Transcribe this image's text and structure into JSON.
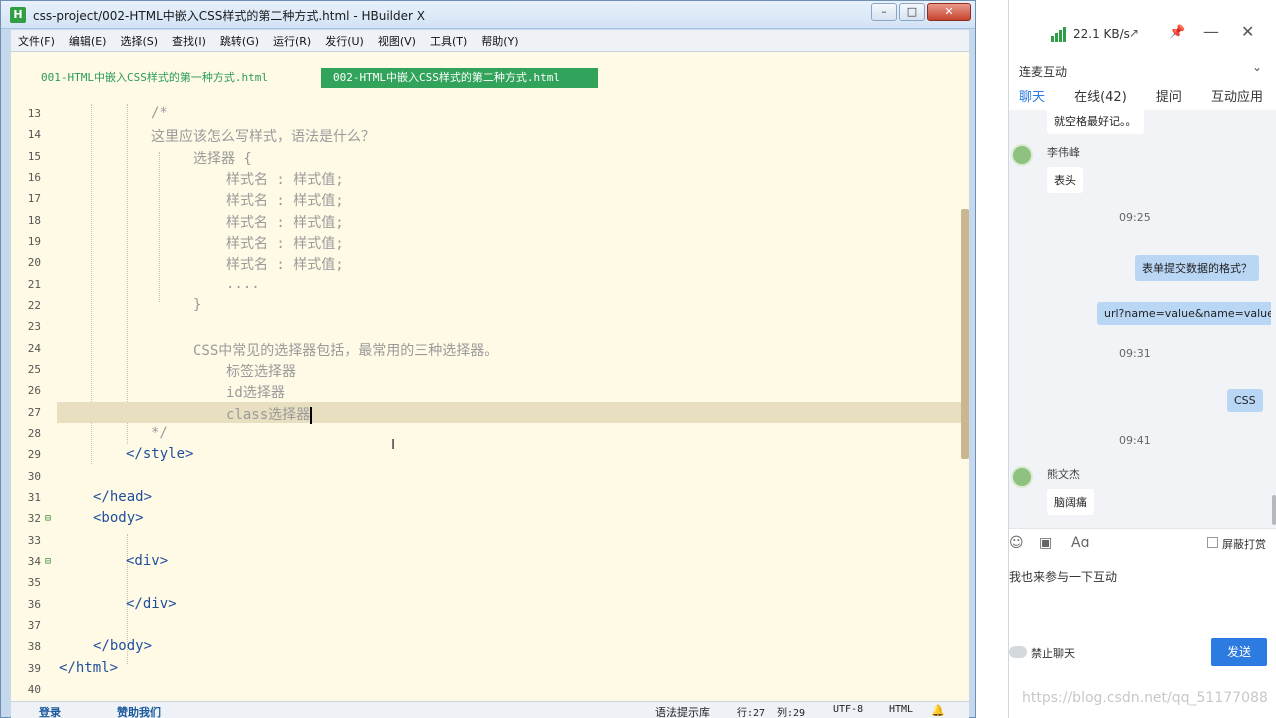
{
  "editor": {
    "title": "css-project/002-HTML中嵌入CSS样式的第二种方式.html - HBuilder X",
    "app_icon": "H",
    "menu": [
      "文件(F)",
      "编辑(E)",
      "选择(S)",
      "查找(I)",
      "跳转(G)",
      "运行(R)",
      "发行(U)",
      "视图(V)",
      "工具(T)",
      "帮助(Y)"
    ],
    "tabs": {
      "inactive": "001-HTML中嵌入CSS样式的第一种方式.html",
      "active": "002-HTML中嵌入CSS样式的第二种方式.html"
    },
    "lines": [
      {
        "num": "13",
        "text": "/*"
      },
      {
        "num": "14",
        "text": "这里应该怎么写样式，语法是什么？"
      },
      {
        "num": "15",
        "text": "选择器 {"
      },
      {
        "num": "16",
        "text": "样式名 : 样式值;"
      },
      {
        "num": "17",
        "text": "样式名 : 样式值;"
      },
      {
        "num": "18",
        "text": "样式名 : 样式值;"
      },
      {
        "num": "19",
        "text": "样式名 : 样式值;"
      },
      {
        "num": "20",
        "text": "样式名 : 样式值;"
      },
      {
        "num": "21",
        "text": "...."
      },
      {
        "num": "22",
        "text": "}"
      },
      {
        "num": "23",
        "text": ""
      },
      {
        "num": "24",
        "text": "CSS中常见的选择器包括，最常用的三种选择器。"
      },
      {
        "num": "25",
        "text": "标签选择器"
      },
      {
        "num": "26",
        "text": "id选择器"
      },
      {
        "num": "27",
        "text": "class选择器"
      },
      {
        "num": "28",
        "text": "*/"
      },
      {
        "num": "29",
        "text": "</style>"
      },
      {
        "num": "30",
        "text": ""
      },
      {
        "num": "31",
        "text": "</head>"
      },
      {
        "num": "32",
        "text": "<body>"
      },
      {
        "num": "33",
        "text": ""
      },
      {
        "num": "34",
        "text": "<div>"
      },
      {
        "num": "35",
        "text": ""
      },
      {
        "num": "36",
        "text": "</div>"
      },
      {
        "num": "37",
        "text": ""
      },
      {
        "num": "38",
        "text": "</body>"
      },
      {
        "num": "39",
        "text": "</html>"
      },
      {
        "num": "40",
        "text": ""
      }
    ],
    "status": {
      "login": "登录",
      "support": "赞助我们",
      "syntax": "语法提示库",
      "row": "行:27",
      "col": "列:29",
      "encoding": "UTF-8",
      "lang": "HTML"
    }
  },
  "chat": {
    "speed": "22.1 KB/s",
    "section": "连麦互动",
    "tabs": [
      "聊天",
      "在线(42)",
      "提问",
      "互动应用"
    ],
    "messages": {
      "m0": "就空格最好记。。",
      "sender1": "李伟峰",
      "m1": "表头",
      "t1": "09:25",
      "m2": "表单提交数据的格式？",
      "m3": "url?name=value&name=value",
      "t2": "09:31",
      "m4": "CSS",
      "t3": "09:41",
      "sender2": "熊文杰",
      "m5": "脑阔痛"
    },
    "mute_label": "屏蔽打赏",
    "input_text": "我也来参与一下互动",
    "ban_label": "禁止聊天",
    "send": "发送"
  },
  "watermark": "https://blog.csdn.net/qq_51177088"
}
